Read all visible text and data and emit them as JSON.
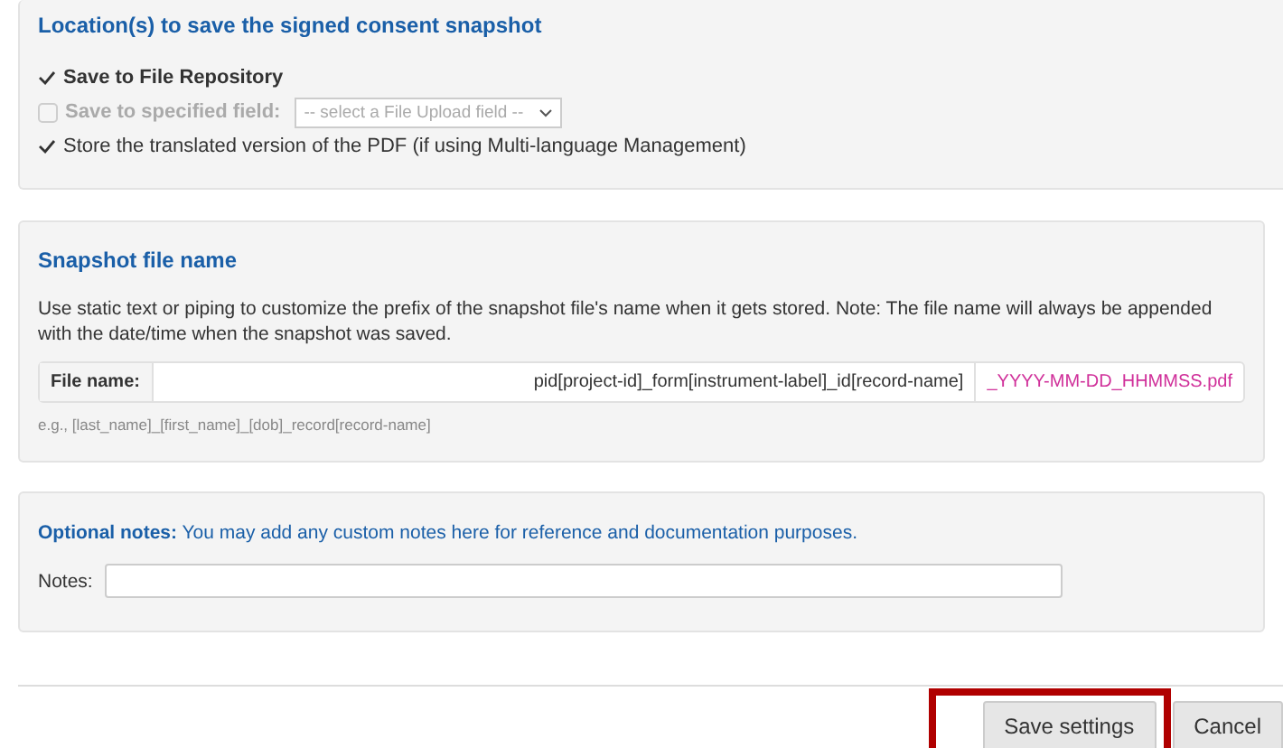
{
  "location_panel": {
    "title": "Location(s) to save the signed consent snapshot",
    "options": [
      {
        "kind": "tick",
        "label": "Save to File Repository",
        "checked": true,
        "disabled": false
      },
      {
        "kind": "checkbox",
        "label": "Save to specified field:",
        "checked": false,
        "disabled": true,
        "select_value": "-- select a File Upload field --"
      },
      {
        "kind": "tick",
        "label": "Store the translated version of the PDF (if using Multi-language Management)",
        "checked": true,
        "disabled": false
      }
    ]
  },
  "filename_panel": {
    "title": "Snapshot file name",
    "description": "Use static text or piping to customize the prefix of the snapshot file's name when it gets stored. Note: The file name will always be appended with the date/time when the snapshot was saved.",
    "field_label": "File name:",
    "field_value": "pid[project-id]_form[instrument-label]_id[record-name]",
    "suffix": "_YYYY-MM-DD_HHMMSS.pdf",
    "example": "e.g., [last_name]_[first_name]_[dob]_record[record-name]"
  },
  "notes_panel": {
    "intro": "**Optional notes:** You may add any custom notes here for reference and documentation purposes.",
    "label": "Notes:"
  },
  "buttons": [
    {
      "label": "Save settings",
      "highlighted": true
    },
    {
      "label": "Cancel",
      "highlighted": false
    }
  ]
}
